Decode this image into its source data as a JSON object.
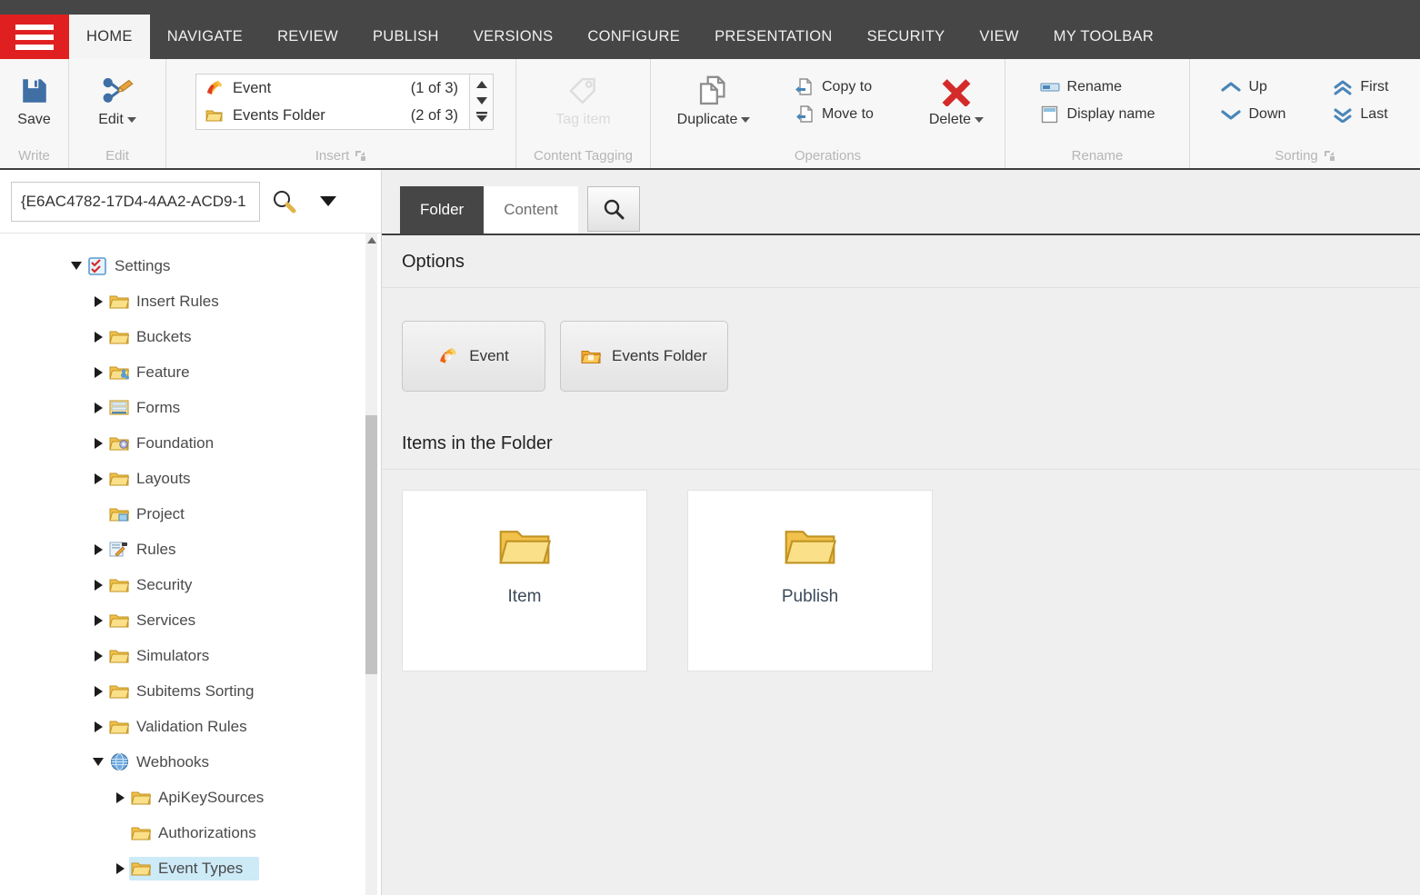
{
  "ribbon": {
    "tabs": [
      {
        "label": "HOME",
        "active": true
      },
      {
        "label": "NAVIGATE",
        "active": false
      },
      {
        "label": "REVIEW",
        "active": false
      },
      {
        "label": "PUBLISH",
        "active": false
      },
      {
        "label": "VERSIONS",
        "active": false
      },
      {
        "label": "CONFIGURE",
        "active": false
      },
      {
        "label": "PRESENTATION",
        "active": false
      },
      {
        "label": "SECURITY",
        "active": false
      },
      {
        "label": "VIEW",
        "active": false
      },
      {
        "label": "MY TOOLBAR",
        "active": false
      }
    ],
    "groups": {
      "write": {
        "title": "Write",
        "save_label": "Save"
      },
      "edit": {
        "title": "Edit",
        "edit_label": "Edit"
      },
      "insert": {
        "title": "Insert",
        "items": [
          {
            "label": "Event",
            "count": "(1 of 3)",
            "icon": "event-icon"
          },
          {
            "label": "Events Folder",
            "count": "(2 of 3)",
            "icon": "folder-icon"
          }
        ]
      },
      "content_tagging": {
        "title": "Content Tagging",
        "tag_item_label": "Tag item"
      },
      "operations": {
        "title": "Operations",
        "duplicate_label": "Duplicate",
        "copy_to_label": "Copy to",
        "move_to_label": "Move to",
        "delete_label": "Delete"
      },
      "rename": {
        "title": "Rename",
        "rename_label": "Rename",
        "display_name_label": "Display name"
      },
      "sorting": {
        "title": "Sorting",
        "up_label": "Up",
        "down_label": "Down",
        "first_label": "First",
        "last_label": "Last"
      }
    }
  },
  "search": {
    "value": "{E6AC4782-17D4-4AA2-ACD9-1",
    "placeholder": "Search"
  },
  "tree": {
    "items": [
      {
        "label": "Settings",
        "indent": 0,
        "twist": "down",
        "icon": "settings-icon",
        "selected": false
      },
      {
        "label": "Insert Rules",
        "indent": 1,
        "twist": "right",
        "icon": "folder-icon",
        "selected": false
      },
      {
        "label": "Buckets",
        "indent": 1,
        "twist": "right",
        "icon": "folder-icon",
        "selected": false
      },
      {
        "label": "Feature",
        "indent": 1,
        "twist": "right",
        "icon": "feature-icon",
        "selected": false
      },
      {
        "label": "Forms",
        "indent": 1,
        "twist": "right",
        "icon": "forms-icon",
        "selected": false
      },
      {
        "label": "Foundation",
        "indent": 1,
        "twist": "right",
        "icon": "foundation-icon",
        "selected": false
      },
      {
        "label": "Layouts",
        "indent": 1,
        "twist": "right",
        "icon": "folder-icon",
        "selected": false
      },
      {
        "label": "Project",
        "indent": 1,
        "twist": "none",
        "icon": "project-icon",
        "selected": false
      },
      {
        "label": "Rules",
        "indent": 1,
        "twist": "right",
        "icon": "rules-icon",
        "selected": false
      },
      {
        "label": "Security",
        "indent": 1,
        "twist": "right",
        "icon": "folder-icon",
        "selected": false
      },
      {
        "label": "Services",
        "indent": 1,
        "twist": "right",
        "icon": "folder-icon",
        "selected": false
      },
      {
        "label": "Simulators",
        "indent": 1,
        "twist": "right",
        "icon": "folder-icon",
        "selected": false
      },
      {
        "label": "Subitems Sorting",
        "indent": 1,
        "twist": "right",
        "icon": "folder-icon",
        "selected": false
      },
      {
        "label": "Validation Rules",
        "indent": 1,
        "twist": "right",
        "icon": "folder-icon",
        "selected": false
      },
      {
        "label": "Webhooks",
        "indent": 1,
        "twist": "down",
        "icon": "globe-icon",
        "selected": false
      },
      {
        "label": "ApiKeySources",
        "indent": 2,
        "twist": "right",
        "icon": "folder-icon",
        "selected": false
      },
      {
        "label": "Authorizations",
        "indent": 2,
        "twist": "none",
        "icon": "folder-icon",
        "selected": false
      },
      {
        "label": "Event Types",
        "indent": 2,
        "twist": "right",
        "icon": "folder-icon",
        "selected": true
      }
    ]
  },
  "content": {
    "tabs": [
      {
        "label": "Folder",
        "active": true
      },
      {
        "label": "Content",
        "active": false
      }
    ],
    "options_title": "Options",
    "option_buttons": [
      {
        "label": "Event",
        "icon": "event-icon"
      },
      {
        "label": "Events Folder",
        "icon": "folder-icon"
      }
    ],
    "items_title": "Items in the Folder",
    "cards": [
      {
        "label": "Item",
        "icon": "folder-icon"
      },
      {
        "label": "Publish",
        "icon": "folder-icon"
      }
    ]
  },
  "colors": {
    "brand_red": "#e02020",
    "ribbon_dark": "#464646",
    "selection_blue": "#cdeaf7",
    "panel_grey": "#efefef",
    "icon_blue": "#4a86b8",
    "delete_red": "#d42a2a"
  }
}
